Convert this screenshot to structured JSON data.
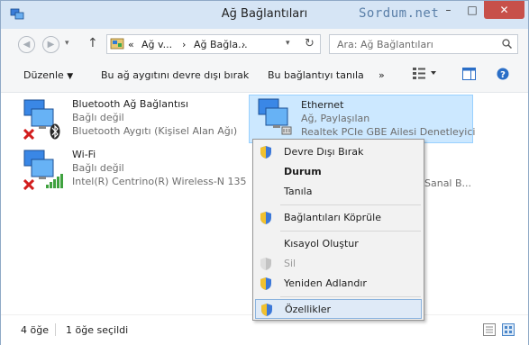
{
  "window": {
    "title": "Ağ Bağlantıları",
    "watermark": "Sordum.net",
    "minimize": "–",
    "maximize": "□",
    "close": "✕"
  },
  "navbar": {
    "crumb_prefix": "«",
    "crumbs": [
      "Ağ v...",
      "Ağ Bağla..."
    ],
    "crumb_sep": "›",
    "search_placeholder": "Ara: Ağ Bağlantıları"
  },
  "commandbar": {
    "organize": "Düzenle",
    "disable_device": "Bu ağ aygıtını devre dışı bırak",
    "diagnose": "Bu bağlantıyı tanıla",
    "more": "»"
  },
  "connections": [
    {
      "name": "Bluetooth Ağ Bağlantısı",
      "status": "Bağlı değil",
      "device": "Bluetooth Aygıtı (Kişisel Alan Ağı)"
    },
    {
      "name": "Ethernet",
      "status": "Ağ, Paylaşılan",
      "device": "Realtek PCIe GBE Ailesi Denetleyici"
    },
    {
      "name": "Wi-Fi",
      "status": "Bağlı değil",
      "device": "Intel(R) Centrino(R) Wireless-N 135"
    }
  ],
  "obscured_text": "Sanal B...",
  "context_menu": [
    {
      "label": "Devre Dışı Bırak",
      "shield": true
    },
    {
      "label": "Durum",
      "bold": true
    },
    {
      "label": "Tanıla"
    },
    {
      "label": "Bağlantıları Köprüle",
      "shield": true
    },
    {
      "label": "Kısayol Oluştur"
    },
    {
      "label": "Sil",
      "shield": true,
      "disabled": true
    },
    {
      "label": "Yeniden Adlandır",
      "shield": true
    },
    {
      "label": "Özellikler",
      "shield": true,
      "highlighted": true
    }
  ],
  "statusbar": {
    "item_count": "4 öğe",
    "selected_count": "1 öğe seçildi"
  },
  "colors": {
    "selection": "#cce8ff",
    "close_button": "#c7504a",
    "accent": "#0078d7"
  }
}
